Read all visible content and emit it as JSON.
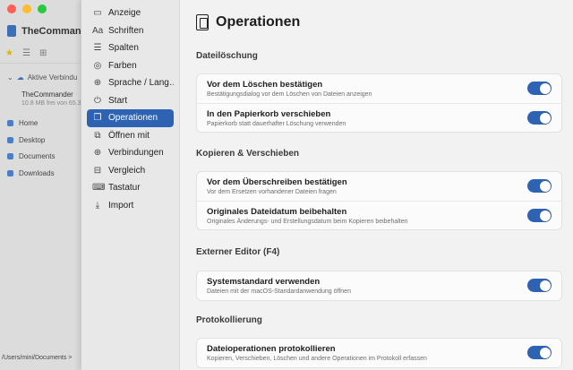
{
  "background_app": {
    "title": "TheCommande",
    "volumes_label": "Aktive Verbindu",
    "volume_name": "TheCommander",
    "volume_detail": "10.8 MB frei von 65.3",
    "nav": [
      {
        "label": "Home",
        "icon": "home-icon"
      },
      {
        "label": "Desktop",
        "icon": "desktop-icon"
      },
      {
        "label": "Documents",
        "icon": "documents-icon"
      },
      {
        "label": "Downloads",
        "icon": "downloads-icon"
      }
    ],
    "path": "/Users/mini/Documents >"
  },
  "settings_nav": [
    {
      "label": "Anzeige",
      "icon": "display-icon",
      "glyph": "▭"
    },
    {
      "label": "Schriften",
      "icon": "fonts-icon",
      "glyph": "Aa"
    },
    {
      "label": "Spalten",
      "icon": "columns-icon",
      "glyph": "☰"
    },
    {
      "label": "Farben",
      "icon": "palette-icon",
      "glyph": "◎"
    },
    {
      "label": "Sprache / Lang…",
      "icon": "globe-icon",
      "glyph": "⊕"
    },
    {
      "label": "Start",
      "icon": "power-icon",
      "glyph": "⏻"
    },
    {
      "label": "Operationen",
      "icon": "operations-icon",
      "glyph": "❐",
      "active": true
    },
    {
      "label": "Öffnen mit",
      "icon": "open-with-icon",
      "glyph": "⧉"
    },
    {
      "label": "Verbindungen",
      "icon": "connections-icon",
      "glyph": "⊕"
    },
    {
      "label": "Vergleich",
      "icon": "compare-icon",
      "glyph": "⊟"
    },
    {
      "label": "Tastatur",
      "icon": "keyboard-icon",
      "glyph": "⌨"
    },
    {
      "label": "Import",
      "icon": "import-icon",
      "glyph": "⤓"
    }
  ],
  "page": {
    "title": "Operationen",
    "sections": [
      {
        "title": "Dateilöschung",
        "rows": [
          {
            "label": "Vor dem Löschen bestätigen",
            "desc": "Bestätigungsdialog vor dem Löschen von Dateien anzeigen",
            "enabled": true
          },
          {
            "label": "In den Papierkorb verschieben",
            "desc": "Papierkorb statt dauerhafter Löschung verwenden",
            "enabled": true
          }
        ]
      },
      {
        "title": "Kopieren & Verschieben",
        "rows": [
          {
            "label": "Vor dem Überschreiben bestätigen",
            "desc": "Vor dem Ersetzen vorhandener Dateien fragen",
            "enabled": true
          },
          {
            "label": "Originales Dateidatum beibehalten",
            "desc": "Originales Änderungs- und Erstellungsdatum beim Kopieren beibehalten",
            "enabled": true
          }
        ]
      },
      {
        "title": "Externer Editor (F4)",
        "rows": [
          {
            "label": "Systemstandard verwenden",
            "desc": "Dateien mit der macOS-Standardanwendung öffnen",
            "enabled": true
          }
        ]
      },
      {
        "title": "Protokollierung",
        "rows": [
          {
            "label": "Dateioperationen protokollieren",
            "desc": "Kopieren, Verschieben, Löschen und andere Operationen im Protokoll erfassen",
            "enabled": true
          }
        ]
      }
    ]
  },
  "colors": {
    "accent": "#2e63b4"
  }
}
